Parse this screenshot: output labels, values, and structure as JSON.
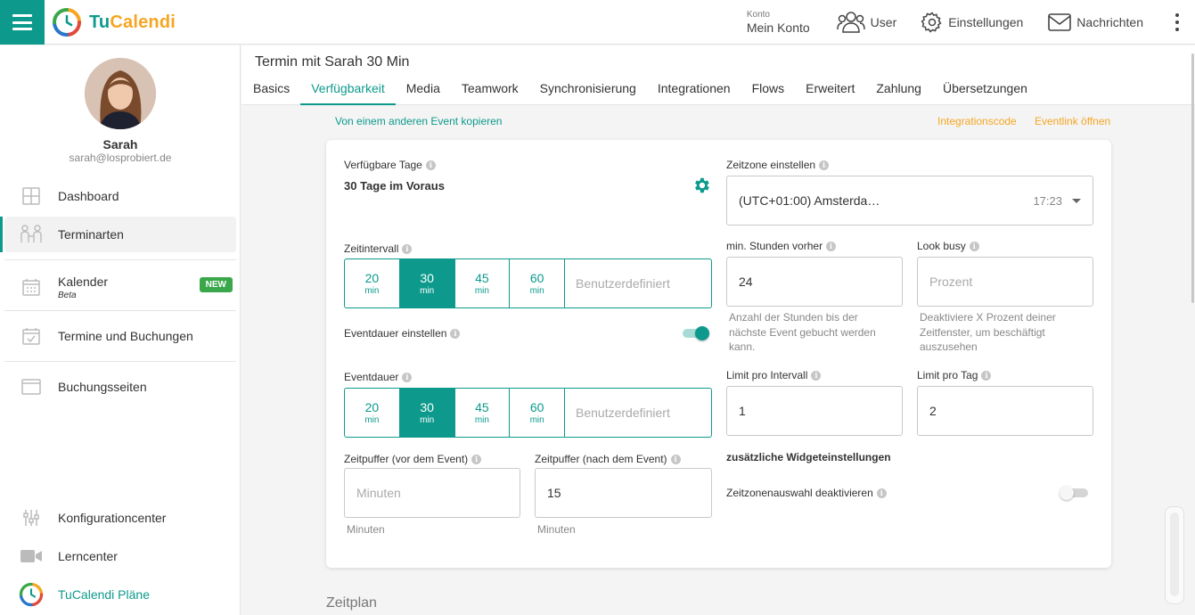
{
  "app": {
    "logo_text_a": "Tu",
    "logo_text_b": "Calendi"
  },
  "topnav": {
    "konto_small": "Konto",
    "konto_label": "Mein Konto",
    "user_label": "User",
    "settings_label": "Einstellungen",
    "messages_label": "Nachrichten"
  },
  "profile": {
    "name": "Sarah",
    "email": "sarah@losprobiert.de"
  },
  "sidebar": {
    "items": [
      {
        "label": "Dashboard",
        "icon": "grid-icon"
      },
      {
        "label": "Terminarten",
        "icon": "people-icon"
      },
      {
        "label": "Kalender",
        "sub": "Beta",
        "badge": "NEW",
        "icon": "calendar-icon"
      },
      {
        "label": "Termine und Buchungen",
        "icon": "calendar-check-icon"
      },
      {
        "label": "Buchungsseiten",
        "icon": "browser-window-icon"
      },
      {
        "label": "Konfigurationcenter",
        "icon": "sliders-icon"
      },
      {
        "label": "Lerncenter",
        "icon": "video-camera-icon"
      },
      {
        "label": "TuCalendi Pläne",
        "icon": "tucalendi-logo-icon"
      }
    ]
  },
  "header": {
    "title": "Termin mit Sarah 30 Min",
    "tabs": [
      "Basics",
      "Verfügbarkeit",
      "Media",
      "Teamwork",
      "Synchronisierung",
      "Integrationen",
      "Flows",
      "Erweitert",
      "Zahlung",
      "Übersetzungen"
    ],
    "active_tab": "Verfügbarkeit"
  },
  "links": {
    "copy_event": "Von einem anderen Event kopieren",
    "integration_code": "Integrationscode",
    "open_eventlink": "Eventlink öffnen"
  },
  "form": {
    "available_days_label": "Verfügbare Tage",
    "available_days_value": "30 Tage im Voraus",
    "timezone_label": "Zeitzone einstellen",
    "timezone_value": "(UTC+01:00) Amsterda…",
    "timezone_time": "17:23",
    "interval_label": "Zeitintervall",
    "interval_options": [
      {
        "n": "20",
        "u": "min"
      },
      {
        "n": "30",
        "u": "min"
      },
      {
        "n": "45",
        "u": "min"
      },
      {
        "n": "60",
        "u": "min"
      }
    ],
    "interval_selected": "30",
    "custom_placeholder": "Benutzerdefiniert",
    "min_hours_label": "min. Stunden vorher",
    "min_hours_value": "24",
    "min_hours_hint": "Anzahl der Stunden bis der nächste Event gebucht werden kann.",
    "look_busy_label": "Look busy",
    "look_busy_placeholder": "Prozent",
    "look_busy_hint": "Deaktiviere X Prozent deiner Zeitfenster, um beschäftigt auszusehen",
    "set_duration_label": "Eventdauer einstellen",
    "set_duration_on": true,
    "duration_label": "Eventdauer",
    "duration_selected": "30",
    "limit_interval_label": "Limit pro Intervall",
    "limit_interval_value": "1",
    "limit_day_label": "Limit pro Tag",
    "limit_day_value": "2",
    "widget_settings_label": "zusätzliche Widgeteinstellungen",
    "tz_select_disable_label": "Zeitzonenauswahl deaktivieren",
    "tz_select_disable_on": false,
    "buffer_before_label": "Zeitpuffer (vor dem Event)",
    "buffer_before_placeholder": "Minuten",
    "buffer_before_unit": "Minuten",
    "buffer_after_label": "Zeitpuffer (nach dem Event)",
    "buffer_after_value": "15",
    "buffer_after_unit": "Minuten"
  },
  "section_next": "Zeitplan",
  "colors": {
    "accent": "#0d9a8c",
    "orange": "#f5a623",
    "badge_green": "#3aa84a"
  }
}
